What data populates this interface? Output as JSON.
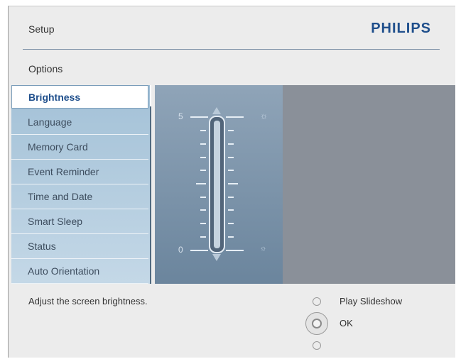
{
  "header": {
    "title": "Setup",
    "brand": "PHILIPS"
  },
  "options_label": "Options",
  "menu": {
    "items": [
      {
        "label": "Brightness",
        "selected": true
      },
      {
        "label": "Language"
      },
      {
        "label": "Memory Card"
      },
      {
        "label": "Event Reminder"
      },
      {
        "label": "Time and Date"
      },
      {
        "label": "Smart Sleep"
      },
      {
        "label": "Status"
      },
      {
        "label": "Auto Orientation"
      }
    ]
  },
  "brightness": {
    "max_label": "5",
    "min_label": "0"
  },
  "help_text": "Adjust the screen brightness.",
  "buttons": {
    "play_slideshow": "Play Slideshow",
    "ok": "OK"
  },
  "colors": {
    "brand": "#1f4f8c",
    "menu_bg": "#b4cde0",
    "panel_bg": "#7f96ad",
    "right_panel_bg": "#8a9099"
  }
}
